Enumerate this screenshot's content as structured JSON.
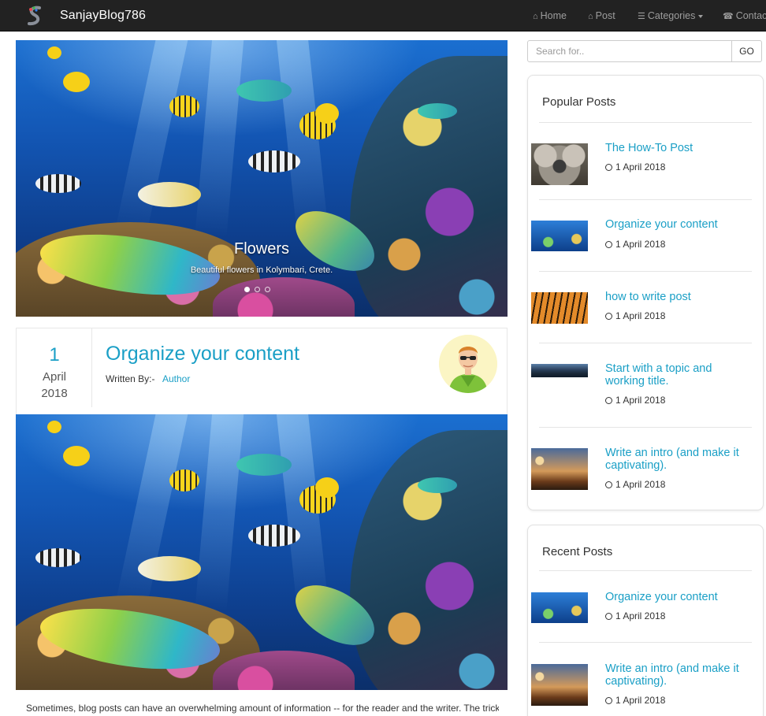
{
  "navbar": {
    "brand": "SanjayBlog786",
    "items": [
      {
        "label": "Home",
        "icon": "home-icon"
      },
      {
        "label": "Post",
        "icon": "home-icon"
      },
      {
        "label": "Categories",
        "icon": "list-icon"
      },
      {
        "label": "Contact",
        "icon": "phone-icon"
      }
    ]
  },
  "carousel": {
    "title": "Flowers",
    "subtitle": "Beautiful flowers in Kolymbari, Crete.",
    "slide_count": 3,
    "active_slide": 1
  },
  "post": {
    "day": "1",
    "month": "April",
    "year": "2018",
    "title": "Organize your content",
    "written_by": "Written By:-",
    "author": "Author",
    "excerpt": "Sometimes, blog posts can have an overwhelming amount of information -- for the reader and the writer. The trick is"
  },
  "search": {
    "placeholder": "Search for..",
    "button": "GO"
  },
  "popular_posts": {
    "title": "Popular Posts",
    "items": [
      {
        "title": "The How-To Post",
        "date": "1 April 2018",
        "thumb": "koala"
      },
      {
        "title": "Organize your content",
        "date": "1 April 2018",
        "thumb": "ocean"
      },
      {
        "title": "how to write post",
        "date": "1 April 2018",
        "thumb": "tiger"
      },
      {
        "title": "Start with a topic and working title.",
        "date": "1 April 2018",
        "thumb": "city"
      },
      {
        "title": "Write an intro (and make it captivating).",
        "date": "1 April 2018",
        "thumb": "sunset"
      }
    ]
  },
  "recent_posts": {
    "title": "Recent Posts",
    "items": [
      {
        "title": "Organize your content",
        "date": "1 April 2018",
        "thumb": "ocean"
      },
      {
        "title": "Write an intro (and make it captivating).",
        "date": "1 April 2018",
        "thumb": "sunset"
      }
    ]
  },
  "colors": {
    "navbar": "#222222",
    "link": "#1a9fc6"
  }
}
